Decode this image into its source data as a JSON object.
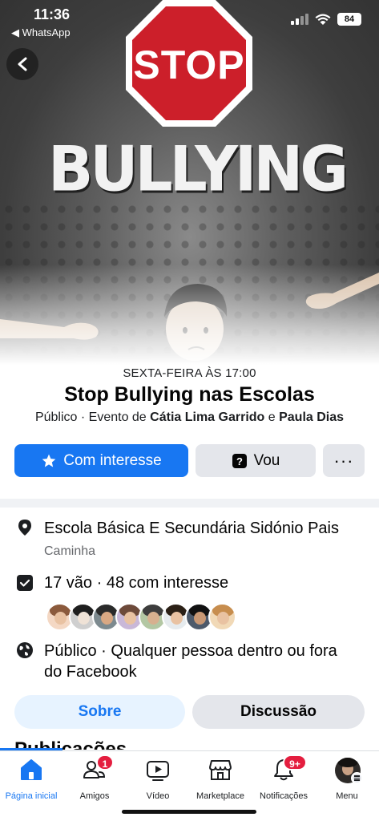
{
  "status_bar": {
    "time": "11:36",
    "back_app": "◀ WhatsApp",
    "battery": "84"
  },
  "hero": {
    "stop_text": "STOP",
    "title_text": "BULLYING",
    "colors": {
      "stop_red": "#cc1f2a",
      "accent": "#1877f2"
    }
  },
  "event": {
    "date": "SEXTA-FEIRA ÀS 17:00",
    "title": "Stop Bullying nas Escolas",
    "privacy": "Público · Evento de ",
    "host1": "Cátia Lima Garrido",
    "joiner": " e ",
    "host2": "Paula Dias"
  },
  "actions": {
    "interest_label": "Com interesse",
    "going_label": "Vou",
    "more_label": "···"
  },
  "details": {
    "location": "Escola Básica E Secundária Sidónio Pais",
    "location_sub": "Caminha",
    "attendance": "17 vão · 48 com interesse",
    "visibility_line1": "Público · Qualquer pessoa dentro ou fora",
    "visibility_line2": "do Facebook"
  },
  "tabs": {
    "about": "Sobre",
    "discussion": "Discussão"
  },
  "posts_heading": "Publicações",
  "bottom_nav": {
    "home": "Página inicial",
    "friends": "Amigos",
    "friends_badge": "1",
    "video": "Vídeo",
    "marketplace": "Marketplace",
    "notifications": "Notificações",
    "notifications_badge": "9+",
    "menu": "Menu"
  }
}
